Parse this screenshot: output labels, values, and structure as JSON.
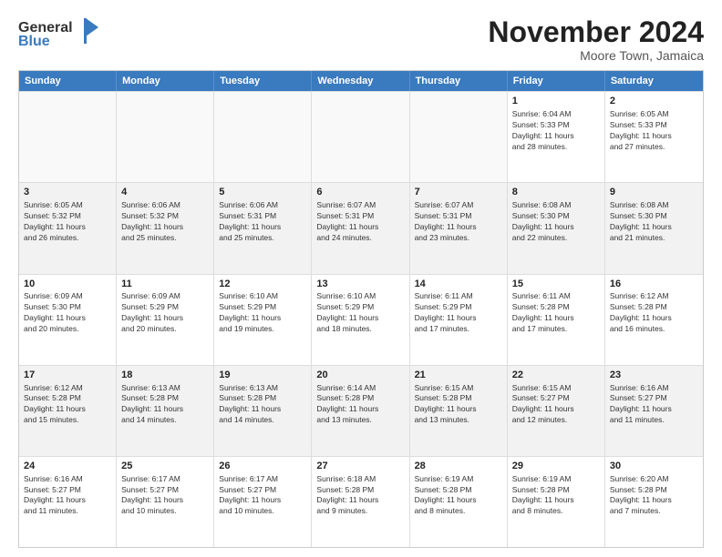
{
  "header": {
    "logo_general": "General",
    "logo_blue": "Blue",
    "month_title": "November 2024",
    "location": "Moore Town, Jamaica"
  },
  "days_of_week": [
    "Sunday",
    "Monday",
    "Tuesday",
    "Wednesday",
    "Thursday",
    "Friday",
    "Saturday"
  ],
  "weeks": [
    [
      {
        "day": "",
        "empty": true
      },
      {
        "day": "",
        "empty": true
      },
      {
        "day": "",
        "empty": true
      },
      {
        "day": "",
        "empty": true
      },
      {
        "day": "",
        "empty": true
      },
      {
        "day": "1",
        "lines": [
          "Sunrise: 6:04 AM",
          "Sunset: 5:33 PM",
          "Daylight: 11 hours",
          "and 28 minutes."
        ]
      },
      {
        "day": "2",
        "lines": [
          "Sunrise: 6:05 AM",
          "Sunset: 5:33 PM",
          "Daylight: 11 hours",
          "and 27 minutes."
        ]
      }
    ],
    [
      {
        "day": "3",
        "lines": [
          "Sunrise: 6:05 AM",
          "Sunset: 5:32 PM",
          "Daylight: 11 hours",
          "and 26 minutes."
        ]
      },
      {
        "day": "4",
        "lines": [
          "Sunrise: 6:06 AM",
          "Sunset: 5:32 PM",
          "Daylight: 11 hours",
          "and 25 minutes."
        ]
      },
      {
        "day": "5",
        "lines": [
          "Sunrise: 6:06 AM",
          "Sunset: 5:31 PM",
          "Daylight: 11 hours",
          "and 25 minutes."
        ]
      },
      {
        "day": "6",
        "lines": [
          "Sunrise: 6:07 AM",
          "Sunset: 5:31 PM",
          "Daylight: 11 hours",
          "and 24 minutes."
        ]
      },
      {
        "day": "7",
        "lines": [
          "Sunrise: 6:07 AM",
          "Sunset: 5:31 PM",
          "Daylight: 11 hours",
          "and 23 minutes."
        ]
      },
      {
        "day": "8",
        "lines": [
          "Sunrise: 6:08 AM",
          "Sunset: 5:30 PM",
          "Daylight: 11 hours",
          "and 22 minutes."
        ]
      },
      {
        "day": "9",
        "lines": [
          "Sunrise: 6:08 AM",
          "Sunset: 5:30 PM",
          "Daylight: 11 hours",
          "and 21 minutes."
        ]
      }
    ],
    [
      {
        "day": "10",
        "lines": [
          "Sunrise: 6:09 AM",
          "Sunset: 5:30 PM",
          "Daylight: 11 hours",
          "and 20 minutes."
        ]
      },
      {
        "day": "11",
        "lines": [
          "Sunrise: 6:09 AM",
          "Sunset: 5:29 PM",
          "Daylight: 11 hours",
          "and 20 minutes."
        ]
      },
      {
        "day": "12",
        "lines": [
          "Sunrise: 6:10 AM",
          "Sunset: 5:29 PM",
          "Daylight: 11 hours",
          "and 19 minutes."
        ]
      },
      {
        "day": "13",
        "lines": [
          "Sunrise: 6:10 AM",
          "Sunset: 5:29 PM",
          "Daylight: 11 hours",
          "and 18 minutes."
        ]
      },
      {
        "day": "14",
        "lines": [
          "Sunrise: 6:11 AM",
          "Sunset: 5:29 PM",
          "Daylight: 11 hours",
          "and 17 minutes."
        ]
      },
      {
        "day": "15",
        "lines": [
          "Sunrise: 6:11 AM",
          "Sunset: 5:28 PM",
          "Daylight: 11 hours",
          "and 17 minutes."
        ]
      },
      {
        "day": "16",
        "lines": [
          "Sunrise: 6:12 AM",
          "Sunset: 5:28 PM",
          "Daylight: 11 hours",
          "and 16 minutes."
        ]
      }
    ],
    [
      {
        "day": "17",
        "lines": [
          "Sunrise: 6:12 AM",
          "Sunset: 5:28 PM",
          "Daylight: 11 hours",
          "and 15 minutes."
        ]
      },
      {
        "day": "18",
        "lines": [
          "Sunrise: 6:13 AM",
          "Sunset: 5:28 PM",
          "Daylight: 11 hours",
          "and 14 minutes."
        ]
      },
      {
        "day": "19",
        "lines": [
          "Sunrise: 6:13 AM",
          "Sunset: 5:28 PM",
          "Daylight: 11 hours",
          "and 14 minutes."
        ]
      },
      {
        "day": "20",
        "lines": [
          "Sunrise: 6:14 AM",
          "Sunset: 5:28 PM",
          "Daylight: 11 hours",
          "and 13 minutes."
        ]
      },
      {
        "day": "21",
        "lines": [
          "Sunrise: 6:15 AM",
          "Sunset: 5:28 PM",
          "Daylight: 11 hours",
          "and 13 minutes."
        ]
      },
      {
        "day": "22",
        "lines": [
          "Sunrise: 6:15 AM",
          "Sunset: 5:27 PM",
          "Daylight: 11 hours",
          "and 12 minutes."
        ]
      },
      {
        "day": "23",
        "lines": [
          "Sunrise: 6:16 AM",
          "Sunset: 5:27 PM",
          "Daylight: 11 hours",
          "and 11 minutes."
        ]
      }
    ],
    [
      {
        "day": "24",
        "lines": [
          "Sunrise: 6:16 AM",
          "Sunset: 5:27 PM",
          "Daylight: 11 hours",
          "and 11 minutes."
        ]
      },
      {
        "day": "25",
        "lines": [
          "Sunrise: 6:17 AM",
          "Sunset: 5:27 PM",
          "Daylight: 11 hours",
          "and 10 minutes."
        ]
      },
      {
        "day": "26",
        "lines": [
          "Sunrise: 6:17 AM",
          "Sunset: 5:27 PM",
          "Daylight: 11 hours",
          "and 10 minutes."
        ]
      },
      {
        "day": "27",
        "lines": [
          "Sunrise: 6:18 AM",
          "Sunset: 5:28 PM",
          "Daylight: 11 hours",
          "and 9 minutes."
        ]
      },
      {
        "day": "28",
        "lines": [
          "Sunrise: 6:19 AM",
          "Sunset: 5:28 PM",
          "Daylight: 11 hours",
          "and 8 minutes."
        ]
      },
      {
        "day": "29",
        "lines": [
          "Sunrise: 6:19 AM",
          "Sunset: 5:28 PM",
          "Daylight: 11 hours",
          "and 8 minutes."
        ]
      },
      {
        "day": "30",
        "lines": [
          "Sunrise: 6:20 AM",
          "Sunset: 5:28 PM",
          "Daylight: 11 hours",
          "and 7 minutes."
        ]
      }
    ]
  ]
}
